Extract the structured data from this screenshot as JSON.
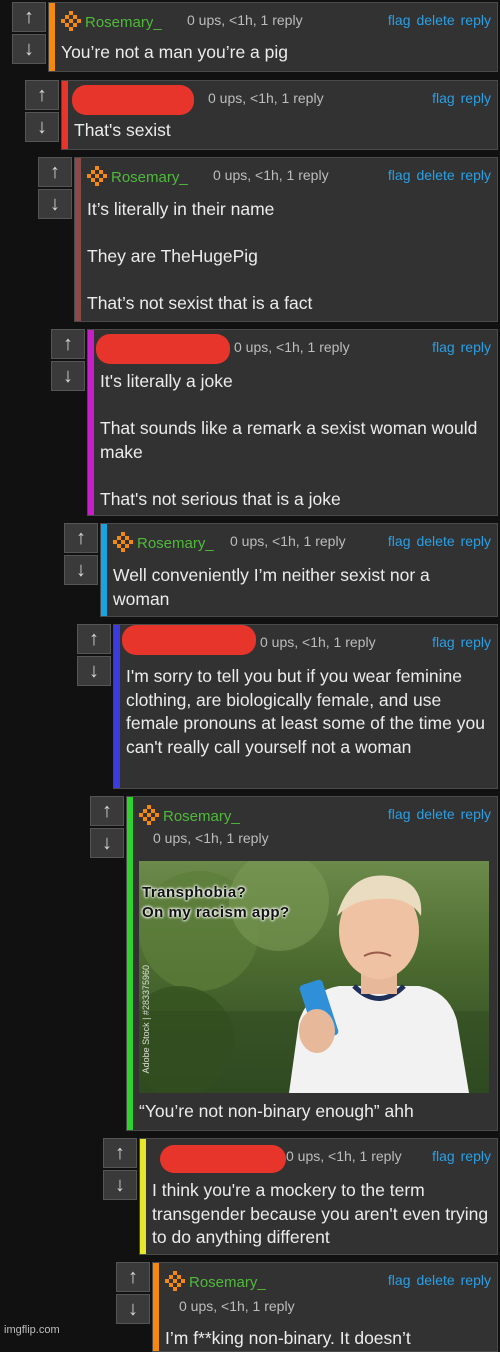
{
  "actions": {
    "flag": "flag",
    "delete": "delete",
    "reply": "reply"
  },
  "vote_icons": {
    "up": "arrow-up-icon",
    "down": "arrow-down-icon"
  },
  "comments": [
    {
      "user": "Rosemary_",
      "meta": "0 ups, <1h, 1 reply",
      "bar_color": "#f5890d",
      "lines": [
        "You’re not a man you’re a pig"
      ]
    },
    {
      "user": "",
      "meta": "0 ups, <1h, 1 reply",
      "bar_color": "#e8352b",
      "lines": [
        "That's sexist"
      ]
    },
    {
      "user": "Rosemary_",
      "meta": "0 ups, <1h, 1 reply",
      "bar_color": "#8b4a4a",
      "lines": [
        "It’s literally in their name",
        "They are TheHugePig",
        "That’s not sexist that is a fact"
      ]
    },
    {
      "user": "",
      "meta": "0 ups, <1h, 1 reply",
      "bar_color": "#c51fc5",
      "lines": [
        "It's literally a joke",
        "That sounds like a remark a sexist woman would make",
        "That's not serious that is a joke"
      ]
    },
    {
      "user": "Rosemary_",
      "meta": "0 ups, <1h, 1 reply",
      "bar_color": "#1aa3e0",
      "lines": [
        "Well conveniently I’m neither sexist nor a woman"
      ]
    },
    {
      "user": "",
      "meta": "0 ups, <1h, 1 reply",
      "bar_color": "#3b3bde",
      "lines": [
        "I'm sorry to tell you but if you wear feminine clothing, are biologically female, and use female pronouns at least some of the time you can't really call yourself not a woman"
      ]
    },
    {
      "user": "Rosemary_",
      "meta": "0 ups, <1h, 1 reply",
      "bar_color": "#2fd12f",
      "meme_caption": "Transphobia?\nOn my racism app?",
      "meme_watermark": "Adobe Stock | #283375960",
      "lines": [
        "“You’re not non-binary enough” ahh"
      ]
    },
    {
      "user": "",
      "meta": "0 ups, <1h, 1 reply",
      "bar_color": "#e6e62a",
      "lines": [
        "I think you're a mockery to the term transgender because you aren't even trying to do anything different"
      ]
    },
    {
      "user": "Rosemary_",
      "meta": "0 ups, <1h, 1 reply",
      "bar_color": "#f5890d",
      "lines": [
        "I’m f**king non-binary. It doesn’t"
      ]
    }
  ],
  "footer": "imgflip.com"
}
